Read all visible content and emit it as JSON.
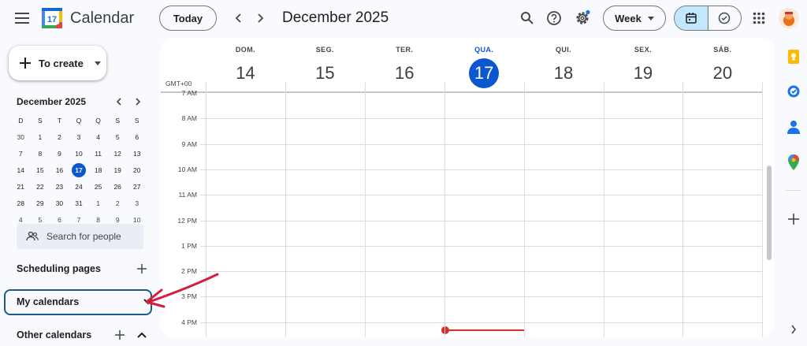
{
  "app": {
    "title": "Calendar",
    "logo_day": "17"
  },
  "header": {
    "today_label": "Today",
    "period": "December 2025",
    "view": "Week",
    "settings_badge_color": "#1a73e8"
  },
  "sidebar": {
    "create_label": "To create",
    "mini_calendar": {
      "title": "December 2025",
      "weekdays": [
        "D",
        "S",
        "T",
        "Q",
        "Q",
        "S",
        "S"
      ],
      "weeks": [
        [
          "30",
          "1",
          "2",
          "3",
          "4",
          "5",
          "6"
        ],
        [
          "7",
          "8",
          "9",
          "10",
          "11",
          "12",
          "13"
        ],
        [
          "14",
          "15",
          "16",
          "17",
          "18",
          "19",
          "20"
        ],
        [
          "21",
          "22",
          "23",
          "24",
          "25",
          "26",
          "27"
        ],
        [
          "28",
          "29",
          "30",
          "31",
          "1",
          "2",
          "3"
        ],
        [
          "4",
          "5",
          "6",
          "7",
          "8",
          "9",
          "10"
        ]
      ],
      "selected": "17"
    },
    "people_placeholder": "Search for people",
    "scheduling_label": "Scheduling pages",
    "my_calendars_label": "My calendars",
    "other_calendars_label": "Other calendars"
  },
  "week": {
    "timezone": "GMT+00",
    "days": [
      {
        "name": "DOM.",
        "num": "14"
      },
      {
        "name": "SEG.",
        "num": "15"
      },
      {
        "name": "TER.",
        "num": "16"
      },
      {
        "name": "QUA.",
        "num": "17",
        "today": true
      },
      {
        "name": "QUI.",
        "num": "18"
      },
      {
        "name": "SEX.",
        "num": "19"
      },
      {
        "name": "SÁB.",
        "num": "20"
      }
    ],
    "hours": [
      "7 AM",
      "8 AM",
      "9 AM",
      "10 AM",
      "11 AM",
      "12 PM",
      "1 PM",
      "2 PM",
      "3 PM",
      "4 PM"
    ]
  },
  "colors": {
    "accent": "#0b57d0",
    "current_time": "#d93025",
    "annotation": "#d21f3c",
    "highlight_box": "#1a5b8c"
  },
  "right_rail": [
    "keep-icon",
    "tasks-icon",
    "contacts-icon",
    "maps-icon",
    "add-addon-icon",
    "expand-panel-icon"
  ]
}
